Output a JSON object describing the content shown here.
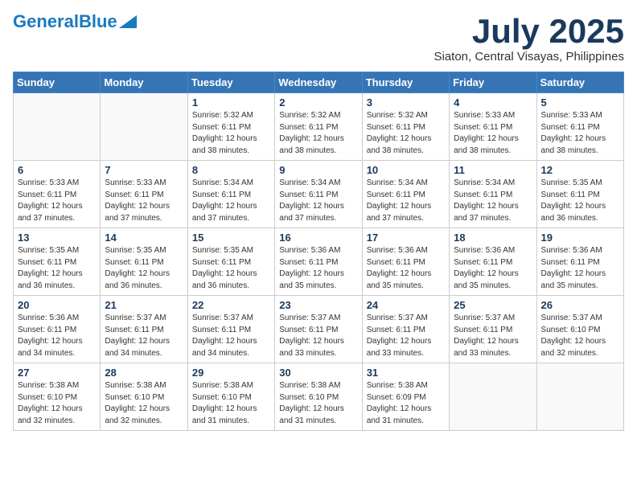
{
  "header": {
    "logo_general": "General",
    "logo_blue": "Blue",
    "month_title": "July 2025",
    "location": "Siaton, Central Visayas, Philippines"
  },
  "weekdays": [
    "Sunday",
    "Monday",
    "Tuesday",
    "Wednesday",
    "Thursday",
    "Friday",
    "Saturday"
  ],
  "weeks": [
    [
      {
        "day": "",
        "sunrise": "",
        "sunset": "",
        "daylight": ""
      },
      {
        "day": "",
        "sunrise": "",
        "sunset": "",
        "daylight": ""
      },
      {
        "day": "1",
        "sunrise": "Sunrise: 5:32 AM",
        "sunset": "Sunset: 6:11 PM",
        "daylight": "Daylight: 12 hours and 38 minutes."
      },
      {
        "day": "2",
        "sunrise": "Sunrise: 5:32 AM",
        "sunset": "Sunset: 6:11 PM",
        "daylight": "Daylight: 12 hours and 38 minutes."
      },
      {
        "day": "3",
        "sunrise": "Sunrise: 5:32 AM",
        "sunset": "Sunset: 6:11 PM",
        "daylight": "Daylight: 12 hours and 38 minutes."
      },
      {
        "day": "4",
        "sunrise": "Sunrise: 5:33 AM",
        "sunset": "Sunset: 6:11 PM",
        "daylight": "Daylight: 12 hours and 38 minutes."
      },
      {
        "day": "5",
        "sunrise": "Sunrise: 5:33 AM",
        "sunset": "Sunset: 6:11 PM",
        "daylight": "Daylight: 12 hours and 38 minutes."
      }
    ],
    [
      {
        "day": "6",
        "sunrise": "Sunrise: 5:33 AM",
        "sunset": "Sunset: 6:11 PM",
        "daylight": "Daylight: 12 hours and 37 minutes."
      },
      {
        "day": "7",
        "sunrise": "Sunrise: 5:33 AM",
        "sunset": "Sunset: 6:11 PM",
        "daylight": "Daylight: 12 hours and 37 minutes."
      },
      {
        "day": "8",
        "sunrise": "Sunrise: 5:34 AM",
        "sunset": "Sunset: 6:11 PM",
        "daylight": "Daylight: 12 hours and 37 minutes."
      },
      {
        "day": "9",
        "sunrise": "Sunrise: 5:34 AM",
        "sunset": "Sunset: 6:11 PM",
        "daylight": "Daylight: 12 hours and 37 minutes."
      },
      {
        "day": "10",
        "sunrise": "Sunrise: 5:34 AM",
        "sunset": "Sunset: 6:11 PM",
        "daylight": "Daylight: 12 hours and 37 minutes."
      },
      {
        "day": "11",
        "sunrise": "Sunrise: 5:34 AM",
        "sunset": "Sunset: 6:11 PM",
        "daylight": "Daylight: 12 hours and 37 minutes."
      },
      {
        "day": "12",
        "sunrise": "Sunrise: 5:35 AM",
        "sunset": "Sunset: 6:11 PM",
        "daylight": "Daylight: 12 hours and 36 minutes."
      }
    ],
    [
      {
        "day": "13",
        "sunrise": "Sunrise: 5:35 AM",
        "sunset": "Sunset: 6:11 PM",
        "daylight": "Daylight: 12 hours and 36 minutes."
      },
      {
        "day": "14",
        "sunrise": "Sunrise: 5:35 AM",
        "sunset": "Sunset: 6:11 PM",
        "daylight": "Daylight: 12 hours and 36 minutes."
      },
      {
        "day": "15",
        "sunrise": "Sunrise: 5:35 AM",
        "sunset": "Sunset: 6:11 PM",
        "daylight": "Daylight: 12 hours and 36 minutes."
      },
      {
        "day": "16",
        "sunrise": "Sunrise: 5:36 AM",
        "sunset": "Sunset: 6:11 PM",
        "daylight": "Daylight: 12 hours and 35 minutes."
      },
      {
        "day": "17",
        "sunrise": "Sunrise: 5:36 AM",
        "sunset": "Sunset: 6:11 PM",
        "daylight": "Daylight: 12 hours and 35 minutes."
      },
      {
        "day": "18",
        "sunrise": "Sunrise: 5:36 AM",
        "sunset": "Sunset: 6:11 PM",
        "daylight": "Daylight: 12 hours and 35 minutes."
      },
      {
        "day": "19",
        "sunrise": "Sunrise: 5:36 AM",
        "sunset": "Sunset: 6:11 PM",
        "daylight": "Daylight: 12 hours and 35 minutes."
      }
    ],
    [
      {
        "day": "20",
        "sunrise": "Sunrise: 5:36 AM",
        "sunset": "Sunset: 6:11 PM",
        "daylight": "Daylight: 12 hours and 34 minutes."
      },
      {
        "day": "21",
        "sunrise": "Sunrise: 5:37 AM",
        "sunset": "Sunset: 6:11 PM",
        "daylight": "Daylight: 12 hours and 34 minutes."
      },
      {
        "day": "22",
        "sunrise": "Sunrise: 5:37 AM",
        "sunset": "Sunset: 6:11 PM",
        "daylight": "Daylight: 12 hours and 34 minutes."
      },
      {
        "day": "23",
        "sunrise": "Sunrise: 5:37 AM",
        "sunset": "Sunset: 6:11 PM",
        "daylight": "Daylight: 12 hours and 33 minutes."
      },
      {
        "day": "24",
        "sunrise": "Sunrise: 5:37 AM",
        "sunset": "Sunset: 6:11 PM",
        "daylight": "Daylight: 12 hours and 33 minutes."
      },
      {
        "day": "25",
        "sunrise": "Sunrise: 5:37 AM",
        "sunset": "Sunset: 6:11 PM",
        "daylight": "Daylight: 12 hours and 33 minutes."
      },
      {
        "day": "26",
        "sunrise": "Sunrise: 5:37 AM",
        "sunset": "Sunset: 6:10 PM",
        "daylight": "Daylight: 12 hours and 32 minutes."
      }
    ],
    [
      {
        "day": "27",
        "sunrise": "Sunrise: 5:38 AM",
        "sunset": "Sunset: 6:10 PM",
        "daylight": "Daylight: 12 hours and 32 minutes."
      },
      {
        "day": "28",
        "sunrise": "Sunrise: 5:38 AM",
        "sunset": "Sunset: 6:10 PM",
        "daylight": "Daylight: 12 hours and 32 minutes."
      },
      {
        "day": "29",
        "sunrise": "Sunrise: 5:38 AM",
        "sunset": "Sunset: 6:10 PM",
        "daylight": "Daylight: 12 hours and 31 minutes."
      },
      {
        "day": "30",
        "sunrise": "Sunrise: 5:38 AM",
        "sunset": "Sunset: 6:10 PM",
        "daylight": "Daylight: 12 hours and 31 minutes."
      },
      {
        "day": "31",
        "sunrise": "Sunrise: 5:38 AM",
        "sunset": "Sunset: 6:09 PM",
        "daylight": "Daylight: 12 hours and 31 minutes."
      },
      {
        "day": "",
        "sunrise": "",
        "sunset": "",
        "daylight": ""
      },
      {
        "day": "",
        "sunrise": "",
        "sunset": "",
        "daylight": ""
      }
    ]
  ]
}
